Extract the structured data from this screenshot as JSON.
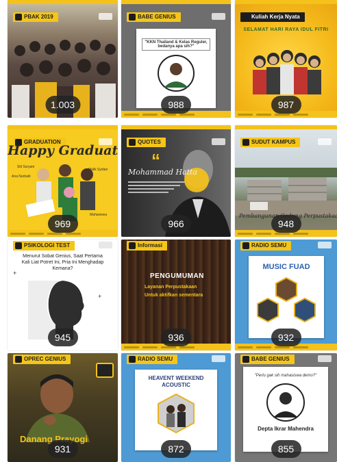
{
  "posts": [
    {
      "category": "PBAK 2019",
      "count": "1.003"
    },
    {
      "category": "BABE GENIUS",
      "quote": "\"KKN Thailand & Kelas Reguler, bedanya apa sih?\"",
      "count": "988"
    },
    {
      "category": "Kuliah Kerja Nyata",
      "headline": "SELAMAT HARI RAYA IDUL FITRI",
      "count": "987"
    },
    {
      "category": "GRADUATION",
      "headline": "Happy Graduation",
      "names": [
        "Siti Suryani",
        "Ana Nurbaiti",
        "Malik Syidan",
        "Mahasiswa"
      ],
      "count": "969"
    },
    {
      "category": "QUOTES",
      "headline": "Mohammad Hatta",
      "count": "966"
    },
    {
      "category": "SUDUT KAMPUS",
      "headline": "Pembangunan Gedung Perpustakaan",
      "count": "948"
    },
    {
      "category": "PSIKOLOGI TEST",
      "headline": "Menurut Sobat Genius, Saat Pertama Kali Liat Potret Ini, Pria Ini Menghadap Kemana?",
      "count": "945"
    },
    {
      "category": "Informasi",
      "headline": "PENGUMUMAN",
      "sub": "Layanan Perpustakaan",
      "sub2": "Untuk aktifkan sementara",
      "count": "936"
    },
    {
      "category": "RADIO SEMU",
      "headline": "MUSIC FUAD",
      "count": "932"
    },
    {
      "category": "OPREC GENIUS",
      "headline": "Danang Prayogi",
      "count": "931"
    },
    {
      "category": "RADIO SEMU",
      "headline": "HEAVENT WEEKEND ACOUSTIC",
      "count": "872"
    },
    {
      "category": "BABE GENIUS",
      "quote": "\"Perlu gak sih mahasiswa demo?\"",
      "headline": "Depta Ikrar Mahendra",
      "count": "855"
    }
  ]
}
